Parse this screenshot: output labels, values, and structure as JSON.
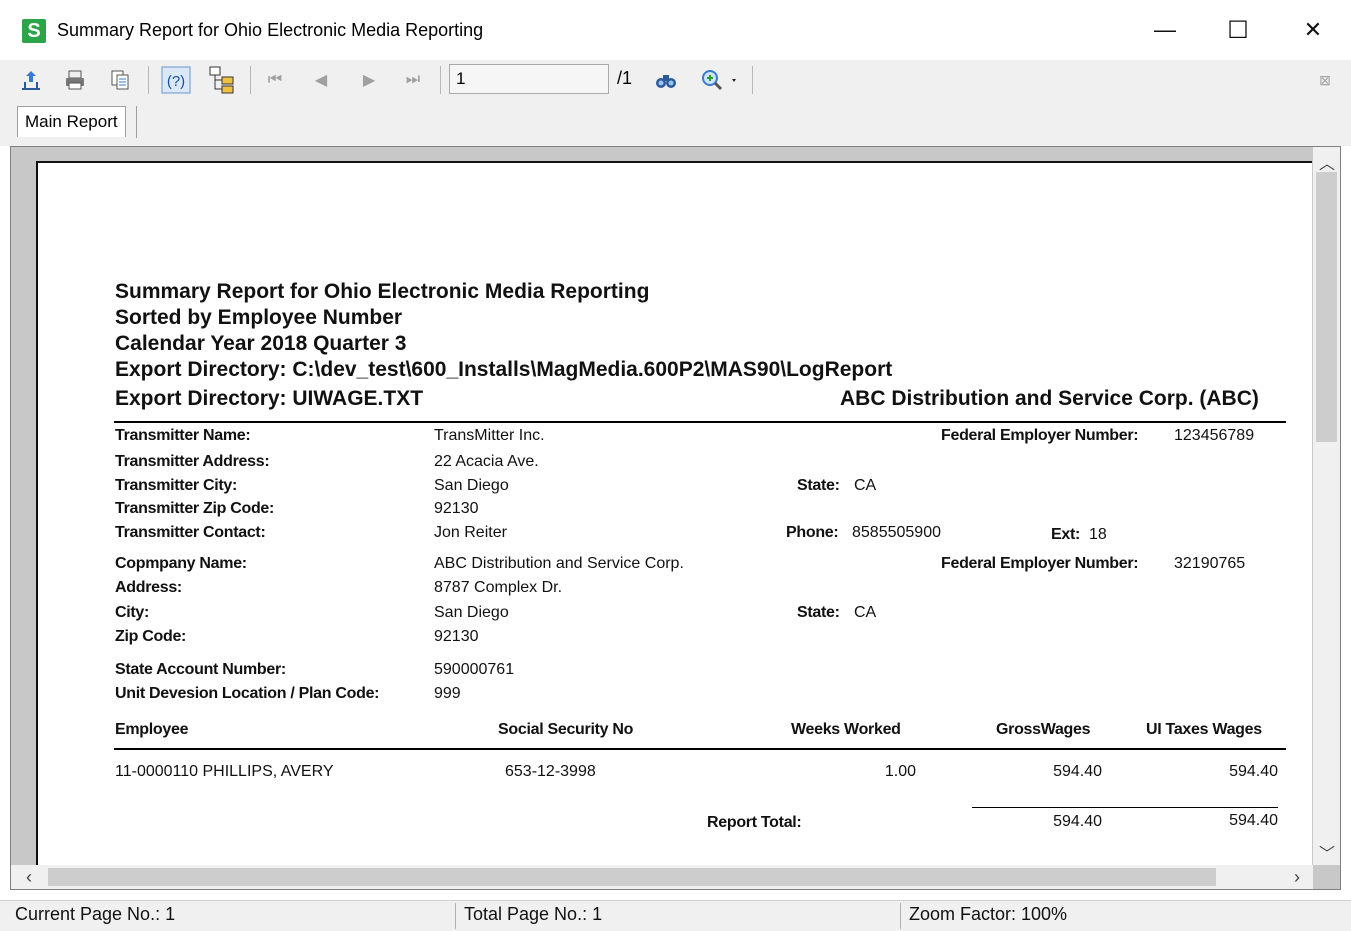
{
  "window": {
    "app_icon_letter": "S",
    "title": "Summary Report for Ohio Electronic Media Reporting",
    "controls": {
      "minimize": "—",
      "maximize": "☐",
      "close": "✕"
    }
  },
  "toolbar": {
    "page_value": "1",
    "page_total": "/1",
    "icons": [
      "export-icon",
      "print-icon",
      "copy-icon",
      "help-icon",
      "group-tree-icon",
      "first-page-icon",
      "previous-page-icon",
      "next-page-icon",
      "last-page-icon",
      "search-icon",
      "zoom-icon",
      "close-view-icon"
    ]
  },
  "tabs": [
    {
      "label": "Main Report"
    }
  ],
  "report": {
    "title": "Summary Report for Ohio Electronic Media Reporting",
    "sorted_by": "Sorted by Employee Number",
    "period": "Calendar Year 2018 Quarter 3",
    "export_dir_path": "Export Directory: C:\\dev_test\\600_Installs\\MagMedia.600P2\\MAS90\\LogReport",
    "export_dir_file": "Export Directory: UIWAGE.TXT",
    "company_header": "ABC Distribution and Service Corp. (ABC)",
    "transmitter": {
      "name_label": "Transmitter Name:",
      "name": "TransMitter Inc.",
      "fein_label": "Federal Employer Number:",
      "fein": "123456789",
      "address_label": "Transmitter Address:",
      "address": "22 Acacia Ave.",
      "city_label": "Transmitter City:",
      "city": "San Diego",
      "state_label": "State:",
      "state": "CA",
      "zip_label": "Transmitter Zip Code:",
      "zip": "92130",
      "contact_label": "Transmitter Contact:",
      "contact": "Jon Reiter",
      "phone_label": "Phone:",
      "phone": "8585505900",
      "ext_label": "Ext:",
      "ext": "18"
    },
    "company": {
      "name_label": "Copmpany Name:",
      "name": "ABC Distribution and Service Corp.",
      "fein_label": "Federal Employer Number:",
      "fein": "32190765",
      "address_label": "Address:",
      "address": "8787 Complex Dr.",
      "city_label": "City:",
      "city": "San Diego",
      "state_label": "State:",
      "state": "CA",
      "zip_label": "Zip Code:",
      "zip": "92130",
      "account_label": "State Account Number:",
      "account": "590000761",
      "unit_label": "Unit Devesion Location / Plan Code:",
      "unit": "999"
    },
    "columns": {
      "employee": "Employee",
      "ssn": "Social Security No",
      "weeks": "Weeks Worked",
      "gross": "GrossWages",
      "ui": "UI Taxes Wages"
    },
    "rows": [
      {
        "employee": "11-0000110   PHILLIPS, AVERY",
        "ssn": "653-12-3998",
        "weeks": "1.00",
        "gross": "594.40",
        "ui": "594.40"
      }
    ],
    "total": {
      "label": "Report Total:",
      "gross": "594.40",
      "ui": "594.40"
    }
  },
  "status": {
    "current_page": "Current Page No.: 1",
    "total_page": "Total Page No.: 1",
    "zoom": "Zoom Factor: 100%"
  }
}
